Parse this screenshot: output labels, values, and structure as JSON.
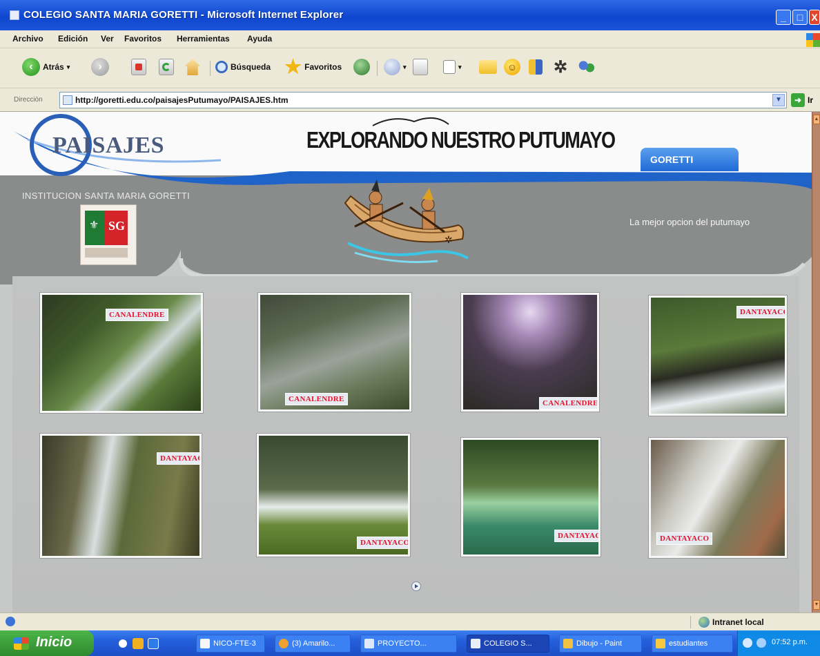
{
  "window": {
    "title": "COLEGIO SANTA MARIA GORETTI - Microsoft Internet Explorer",
    "controls": {
      "minimize": "_",
      "maximize": "□",
      "close": "X"
    }
  },
  "menu": [
    "Archivo",
    "Edición",
    "Ver",
    "Favoritos",
    "Herramientas",
    "Ayuda"
  ],
  "toolbar": {
    "back": "Atrás",
    "search": "Búsqueda",
    "favorites": "Favoritos"
  },
  "address": {
    "label": "Dirección",
    "url": "http://goretti.edu.co/paisajesPutumayo/PAISAJES.htm",
    "go": "Ir"
  },
  "page": {
    "logo_text": "PAISAJES",
    "title": "EXPLORANDO NUESTRO PUTUMAYO",
    "tab": "GORETTI",
    "institution": "INSTITUCION SANTA MARIA GORETTI",
    "slogan": "La mejor opcion del putumayo",
    "photos": [
      {
        "label": "CANALENDRE"
      },
      {
        "label": "CANALENDRE"
      },
      {
        "label": "CANALENDRE"
      },
      {
        "label": "DANTAYACO"
      },
      {
        "label": "DANTAYACO"
      },
      {
        "label": "DANTAYACO"
      },
      {
        "label": "DANTAYACO"
      },
      {
        "label": "DANTAYACO"
      }
    ]
  },
  "status": {
    "zone": "Intranet local"
  },
  "taskbar": {
    "start": "Inicio",
    "tasks": [
      "NICO-FTE-3",
      "(3) Amarilo...",
      "PROYECTO...",
      "COLEGIO S...",
      "Dibujo - Paint",
      "estudiantes"
    ],
    "clock": "07:52 p.m."
  }
}
